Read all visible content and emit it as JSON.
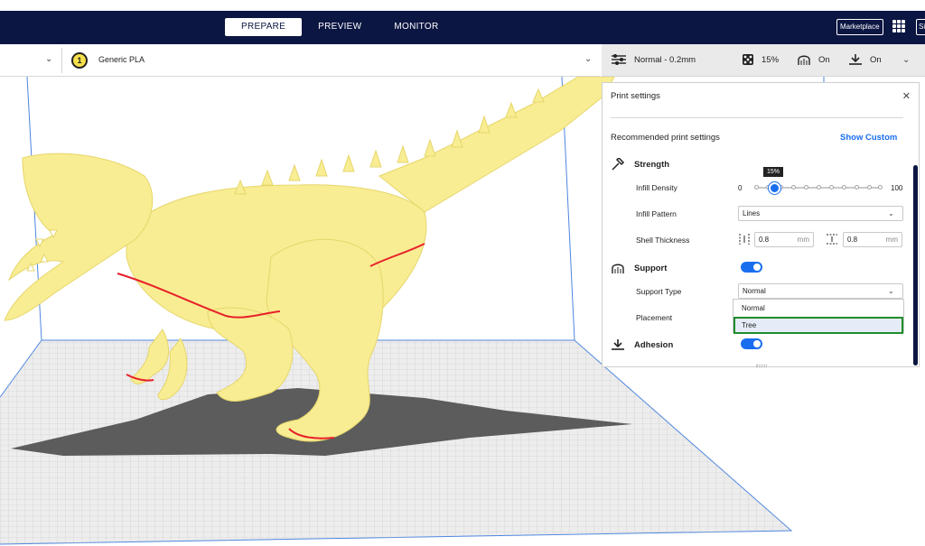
{
  "header": {
    "stages": [
      "PREPARE",
      "PREVIEW",
      "MONITOR"
    ],
    "active_stage": "PREPARE",
    "marketplace_label": "Marketplace",
    "signin_label": "Si"
  },
  "material_bar": {
    "extruder_number": "1",
    "material_name": "Generic PLA"
  },
  "print_bar": {
    "profile": "Normal - 0.2mm",
    "infill": "15%",
    "support": "On",
    "adhesion": "On"
  },
  "print_settings": {
    "title": "Print settings",
    "recommended_title": "Recommended print settings",
    "show_custom_label": "Show Custom",
    "strength": {
      "title": "Strength",
      "infill_density_label": "Infill Density",
      "infill_min": "0",
      "infill_max": "100",
      "infill_value": "15%",
      "infill_fraction": 0.15,
      "infill_pattern_label": "Infill Pattern",
      "infill_pattern_value": "Lines",
      "shell_thickness_label": "Shell Thickness",
      "wall_thickness": "0.8",
      "top_bottom_thickness": "0.8",
      "unit": "mm"
    },
    "support": {
      "title": "Support",
      "enabled": true,
      "support_type_label": "Support Type",
      "support_type_value": "Normal",
      "placement_label": "Placement",
      "dropdown_options": [
        "Normal",
        "Tree"
      ],
      "highlighted_option": "Tree"
    },
    "adhesion": {
      "title": "Adhesion",
      "enabled": true
    }
  },
  "colors": {
    "header_bg": "#0b1642",
    "accent": "#196ef0",
    "model": "#f8ed92",
    "overhang": "#e8202a",
    "highlight_border": "#1f8c2b"
  }
}
